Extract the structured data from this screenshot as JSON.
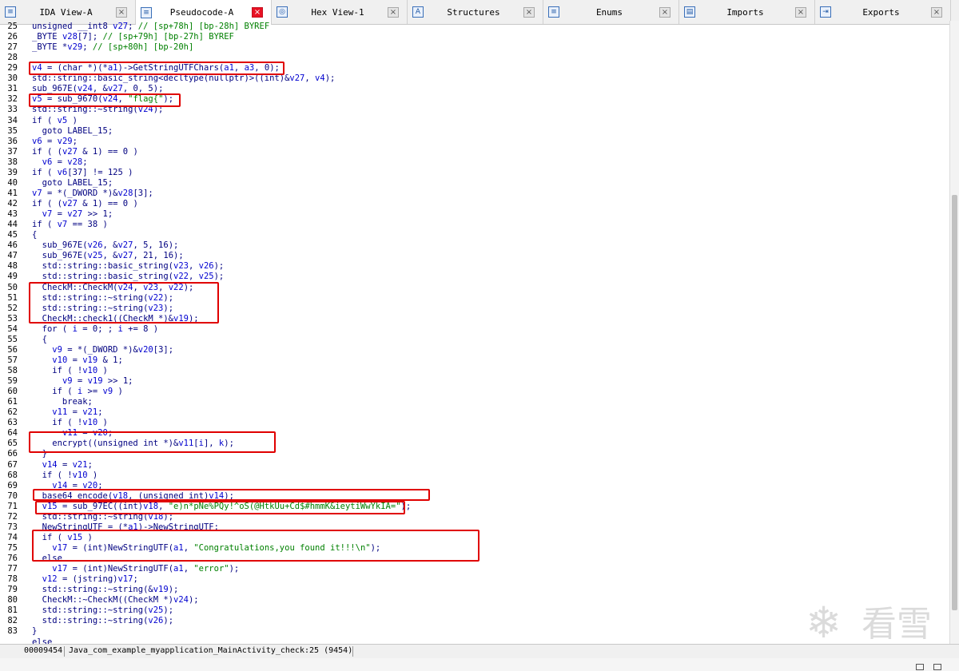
{
  "tabs": [
    {
      "label": "IDA View-A",
      "icon": "ida-view-icon",
      "glyph": "≡",
      "active": false
    },
    {
      "label": "Pseudocode-A",
      "icon": "pseudocode-icon",
      "glyph": "≡",
      "active": true
    },
    {
      "label": "Hex View-1",
      "icon": "hex-view-icon",
      "glyph": "◎",
      "active": false
    },
    {
      "label": "Structures",
      "icon": "structures-icon",
      "glyph": "A",
      "active": false
    },
    {
      "label": "Enums",
      "icon": "enums-icon",
      "glyph": "≡",
      "active": false
    },
    {
      "label": "Imports",
      "icon": "imports-icon",
      "glyph": "▤",
      "active": false
    },
    {
      "label": "Exports",
      "icon": "exports-icon",
      "glyph": "⇥",
      "active": false
    }
  ],
  "tab_close_glyph": "×",
  "colors": {
    "keyword": "#000080",
    "variable": "#0000d0",
    "comment": "#008000",
    "string": "#008000",
    "cast": "#808080",
    "highlight_box": "#e00000"
  },
  "code_lines": [
    {
      "num": "25",
      "text": "unsigned __int8 v27; // [sp+78h] [bp-28h] BYREF"
    },
    {
      "num": "26",
      "text": "_BYTE v28[7]; // [sp+79h] [bp-27h] BYREF"
    },
    {
      "num": "27",
      "text": "_BYTE *v29; // [sp+80h] [bp-20h]"
    },
    {
      "num": "28",
      "text": ""
    },
    {
      "num": "29",
      "text": "v4 = (char *)(*a1)->GetStringUTFChars(a1, a3, 0);"
    },
    {
      "num": "30",
      "text": "std::string::basic_string<decltype(nullptr)>((int)&v27, v4);"
    },
    {
      "num": "31",
      "text": "sub_967E(v24, &v27, 0, 5);"
    },
    {
      "num": "32",
      "text": "v5 = sub_9670(v24, \"flag{\");"
    },
    {
      "num": "33",
      "text": "std::string::~string(v24);"
    },
    {
      "num": "34",
      "text": "if ( v5 )"
    },
    {
      "num": "35",
      "text": "  goto LABEL_15;"
    },
    {
      "num": "36",
      "text": "v6 = v29;"
    },
    {
      "num": "37",
      "text": "if ( (v27 & 1) == 0 )"
    },
    {
      "num": "38",
      "text": "  v6 = v28;"
    },
    {
      "num": "39",
      "text": "if ( v6[37] != 125 )"
    },
    {
      "num": "40",
      "text": "  goto LABEL_15;"
    },
    {
      "num": "41",
      "text": "v7 = *(_DWORD *)&v28[3];"
    },
    {
      "num": "42",
      "text": "if ( (v27 & 1) == 0 )"
    },
    {
      "num": "43",
      "text": "  v7 = v27 >> 1;"
    },
    {
      "num": "44",
      "text": "if ( v7 == 38 )"
    },
    {
      "num": "45",
      "text": "{"
    },
    {
      "num": "46",
      "text": "  sub_967E(v26, &v27, 5, 16);"
    },
    {
      "num": "47",
      "text": "  sub_967E(v25, &v27, 21, 16);"
    },
    {
      "num": "48",
      "text": "  std::string::basic_string(v23, v26);"
    },
    {
      "num": "49",
      "text": "  std::string::basic_string(v22, v25);"
    },
    {
      "num": "50",
      "text": "  CheckM::CheckM(v24, v23, v22);"
    },
    {
      "num": "51",
      "text": "  std::string::~string(v22);"
    },
    {
      "num": "52",
      "text": "  std::string::~string(v23);"
    },
    {
      "num": "53",
      "text": "  CheckM::check1((CheckM *)&v19);"
    },
    {
      "num": "54",
      "text": "  for ( i = 0; ; i += 8 )"
    },
    {
      "num": "55",
      "text": "  {"
    },
    {
      "num": "56",
      "text": "    v9 = *(_DWORD *)&v20[3];"
    },
    {
      "num": "57",
      "text": "    v10 = v19 & 1;"
    },
    {
      "num": "58",
      "text": "    if ( !v10 )"
    },
    {
      "num": "59",
      "text": "      v9 = v19 >> 1;"
    },
    {
      "num": "60",
      "text": "    if ( i >= v9 )"
    },
    {
      "num": "61",
      "text": "      break;"
    },
    {
      "num": "62",
      "text": "    v11 = v21;"
    },
    {
      "num": "63",
      "text": "    if ( !v10 )"
    },
    {
      "num": "64",
      "text": "      v11 = v20;"
    },
    {
      "num": "65",
      "text": "    encrypt((unsigned int *)&v11[i], k);"
    },
    {
      "num": "66",
      "text": "  }"
    },
    {
      "num": "67",
      "text": "  v14 = v21;"
    },
    {
      "num": "68",
      "text": "  if ( !v10 )"
    },
    {
      "num": "69",
      "text": "    v14 = v20;"
    },
    {
      "num": "70",
      "text": "  base64_encode(v18, (unsigned int)v14);"
    },
    {
      "num": "71",
      "text": "  v15 = sub_97EC((int)v18, \"e)n*pNe%PQy!^oS(@HtkUu+Cd$#hmmK&ieytiWwYkIA=\");"
    },
    {
      "num": "72",
      "text": "  std::string::~string(v18);"
    },
    {
      "num": "73",
      "text": "  NewStringUTF = (*a1)->NewStringUTF;"
    },
    {
      "num": "74",
      "text": "  if ( v15 )"
    },
    {
      "num": "75",
      "text": "    v17 = (int)NewStringUTF(a1, \"Congratulations,you found it!!!\\n\");"
    },
    {
      "num": "76",
      "text": "  else"
    },
    {
      "num": "77",
      "text": "    v17 = (int)NewStringUTF(a1, \"error\");"
    },
    {
      "num": "78",
      "text": "  v12 = (jstring)v17;"
    },
    {
      "num": "79",
      "text": "  std::string::~string(&v19);"
    },
    {
      "num": "80",
      "text": "  CheckM::~CheckM((CheckM *)v24);"
    },
    {
      "num": "81",
      "text": "  std::string::~string(v25);"
    },
    {
      "num": "82",
      "text": "  std::string::~string(v26);"
    },
    {
      "num": "83",
      "text": "}"
    },
    {
      "num": "",
      "text": "else"
    }
  ],
  "status": {
    "address": "00009454",
    "function": "Java_com_example_myapplication_MainActivity_check:25 (9454)"
  },
  "watermark": {
    "glyph": "❄",
    "text": "看雪"
  }
}
